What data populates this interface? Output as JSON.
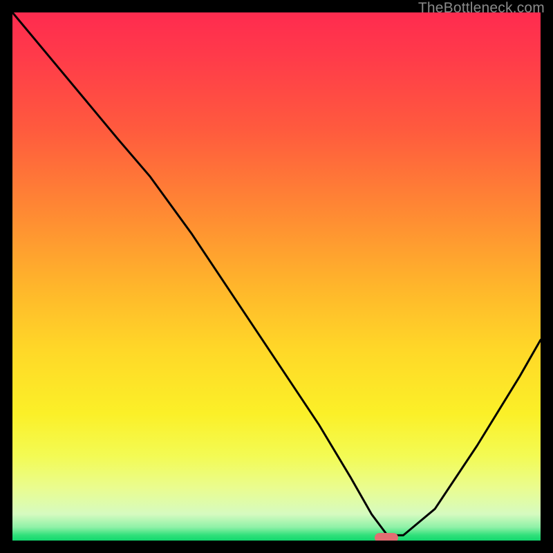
{
  "watermark": "TheBottleneck.com",
  "marker": {
    "x_frac": 0.708,
    "y_frac": 0.995
  },
  "chart_data": {
    "type": "line",
    "title": "",
    "xlabel": "",
    "ylabel": "",
    "xlim": [
      0,
      100
    ],
    "ylim": [
      0,
      100
    ],
    "grid": false,
    "legend": false,
    "series": [
      {
        "name": "bottleneck-curve",
        "x": [
          0,
          10,
          20,
          26,
          34,
          42,
          50,
          58,
          64,
          68,
          71,
          74,
          80,
          88,
          96,
          100
        ],
        "y": [
          100,
          88,
          76,
          69,
          58,
          46,
          34,
          22,
          12,
          5,
          1,
          1,
          6,
          18,
          31,
          38
        ]
      }
    ],
    "marker": {
      "x": 71,
      "y": 0.5
    }
  }
}
